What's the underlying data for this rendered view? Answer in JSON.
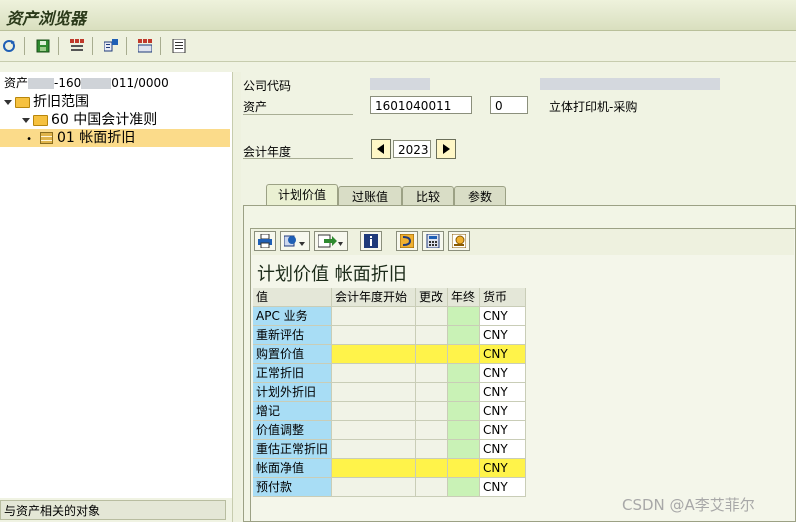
{
  "window": {
    "title": "资产浏览器"
  },
  "toolbar": {
    "icons": [
      "refresh-icon",
      "save-icon",
      "tree-expand-icon",
      "hierarchy-icon",
      "settings-icon",
      "list-icon"
    ]
  },
  "left_panel": {
    "header_prefix": "资产",
    "header_mid": "-160",
    "header_suffix": "011/0000",
    "tree": [
      {
        "label": "折旧范围"
      },
      {
        "label": "60  中国会计准则"
      },
      {
        "label": "01  帐面折旧"
      }
    ],
    "footer": "与资产相关的对象"
  },
  "header": {
    "company_code_label": "公司代码",
    "asset_label": "资产",
    "asset_number": "1601040011",
    "asset_subnumber": "0",
    "asset_description": "立体打印机-采购",
    "fiscal_year_label": "会计年度",
    "fiscal_year": "2023"
  },
  "tabs": [
    {
      "label": "计划价值",
      "active": true
    },
    {
      "label": "过账值",
      "active": false
    },
    {
      "label": "比较",
      "active": false
    },
    {
      "label": "参数",
      "active": false
    }
  ],
  "section_title": "计划价值 帐面折旧",
  "table": {
    "columns": [
      "值",
      "会计年度开始",
      "更改",
      "年终",
      "货币"
    ],
    "rows": [
      {
        "name": "APC 业务",
        "currency": "CNY",
        "highlight": false
      },
      {
        "name": "重新评估",
        "currency": "CNY",
        "highlight": false
      },
      {
        "name": "购置价值",
        "currency": "CNY",
        "highlight": true
      },
      {
        "name": "正常折旧",
        "currency": "CNY",
        "highlight": false
      },
      {
        "name": "计划外折旧",
        "currency": "CNY",
        "highlight": false
      },
      {
        "name": "增记",
        "currency": "CNY",
        "highlight": false
      },
      {
        "name": "价值调整",
        "currency": "CNY",
        "highlight": false
      },
      {
        "name": "重估正常折旧",
        "currency": "CNY",
        "highlight": false
      },
      {
        "name": "帐面净值",
        "currency": "CNY",
        "highlight": true
      },
      {
        "name": "预付款",
        "currency": "CNY",
        "highlight": false
      }
    ]
  },
  "watermark": "CSDN @A李艾菲尔",
  "colors": {
    "name_cell": "#a8ddf5",
    "highlight_row": "#fff34a",
    "year_end_cell": "#c9f2b6",
    "selected_tree_row": "#fbdb8a"
  }
}
